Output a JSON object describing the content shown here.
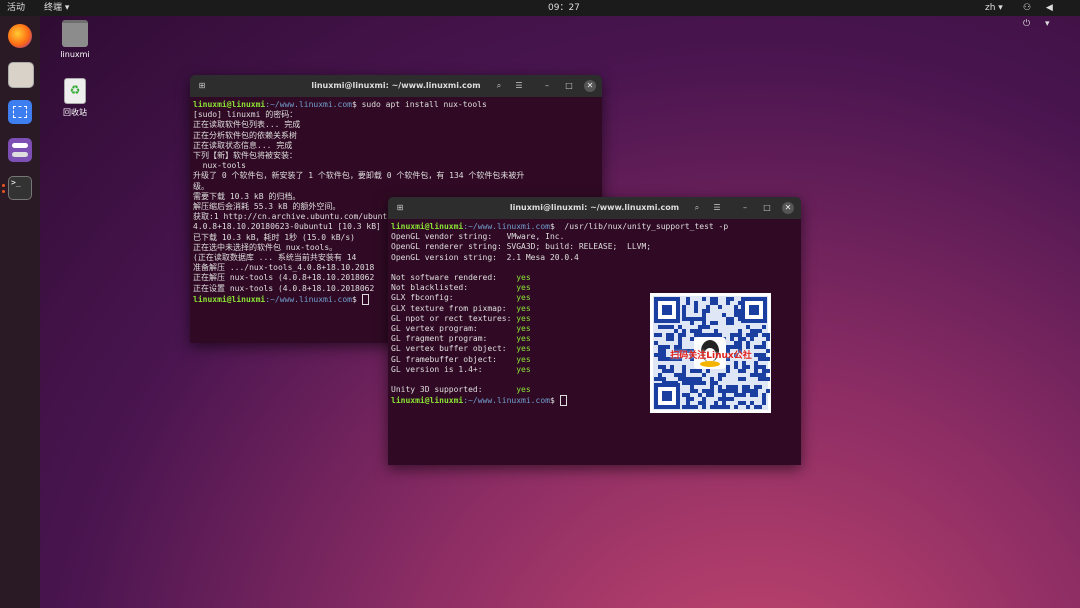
{
  "topbar": {
    "activities": "活动",
    "app_menu": "终端 ▾",
    "clock": "09：27",
    "lang": "zh ▾",
    "sys_icons": "⚇ ◀ ⏻ ▾"
  },
  "desktop": {
    "icons": [
      {
        "label": "linuxmi"
      },
      {
        "label": "回收站"
      }
    ]
  },
  "dock": {
    "items": [
      "firefox-icon",
      "files-icon",
      "screenshot-icon",
      "settings-icon",
      "terminal-icon"
    ]
  },
  "term1": {
    "title": "linuxmi@linuxmi: ~/www.linuxmi.com",
    "lines": [
      {
        "user": "linuxmi@linuxmi",
        "path": ":~/www.linuxmi.com",
        "cmd": "$ sudo apt install nux-tools"
      },
      {
        "text": "[sudo] linuxmi 的密码："
      },
      {
        "text": "正在读取软件包列表... 完成"
      },
      {
        "text": "正在分析软件包的依赖关系树"
      },
      {
        "text": "正在读取状态信息... 完成"
      },
      {
        "text": "下列【新】软件包将被安装："
      },
      {
        "text": "  nux-tools"
      },
      {
        "text": "升级了 0 个软件包，新安装了 1 个软件包，要卸载 0 个软件包，有 134 个软件包未被升"
      },
      {
        "text": "级。"
      },
      {
        "text": "需要下载 10.3 kB 的归档。"
      },
      {
        "text": "解压缩后会消耗 55.3 kB 的额外空间。"
      },
      {
        "text": "获取:1 http://cn.archive.ubuntu.com/ubuntu"
      },
      {
        "text": "4.0.8+18.10.20180623-0ubuntu1 [10.3 kB]"
      },
      {
        "text": "已下载 10.3 kB，耗时 1秒 (15.0 kB/s)"
      },
      {
        "text": "正在选中未选择的软件包 nux-tools。"
      },
      {
        "text": "(正在读取数据库 ... 系统当前共安装有 14"
      },
      {
        "text": "准备解压 .../nux-tools_4.0.8+18.10.2018"
      },
      {
        "text": "正在解压 nux-tools (4.0.8+18.10.2018062"
      },
      {
        "text": "正在设置 nux-tools (4.0.8+18.10.2018062"
      },
      {
        "user": "linuxmi@linuxmi",
        "path": ":~/www.linuxmi.com",
        "cmd": "$ "
      }
    ]
  },
  "term2": {
    "title": "linuxmi@linuxmi: ~/www.linuxmi.com",
    "lines": [
      {
        "user": "linuxmi@linuxmi",
        "path": ":~/www.linuxmi.com",
        "cmd": "$  /usr/lib/nux/unity_support_test -p"
      },
      {
        "text": "OpenGL vendor string:   VMware, Inc."
      },
      {
        "text": "OpenGL renderer string: SVGA3D; build: RELEASE;  LLVM;"
      },
      {
        "text": "OpenGL version string:  2.1 Mesa 20.0.4"
      },
      {
        "text": ""
      },
      {
        "text": "Not software rendered:    ",
        "val": "yes"
      },
      {
        "text": "Not blacklisted:          ",
        "val": "yes"
      },
      {
        "text": "GLX fbconfig:             ",
        "val": "yes"
      },
      {
        "text": "GLX texture from pixmap:  ",
        "val": "yes"
      },
      {
        "text": "GL npot or rect textures: ",
        "val": "yes"
      },
      {
        "text": "GL vertex program:        ",
        "val": "yes"
      },
      {
        "text": "GL fragment program:      ",
        "val": "yes"
      },
      {
        "text": "GL vertex buffer object:  ",
        "val": "yes"
      },
      {
        "text": "GL framebuffer object:    ",
        "val": "yes"
      },
      {
        "text": "GL version is 1.4+:       ",
        "val": "yes"
      },
      {
        "text": ""
      },
      {
        "text": "Unity 3D supported:       ",
        "val": "yes"
      },
      {
        "user": "linuxmi@linuxmi",
        "path": ":~/www.linuxmi.com",
        "cmd": "$ "
      }
    ]
  },
  "qr": {
    "caption": "扫码关注Linux公社"
  }
}
